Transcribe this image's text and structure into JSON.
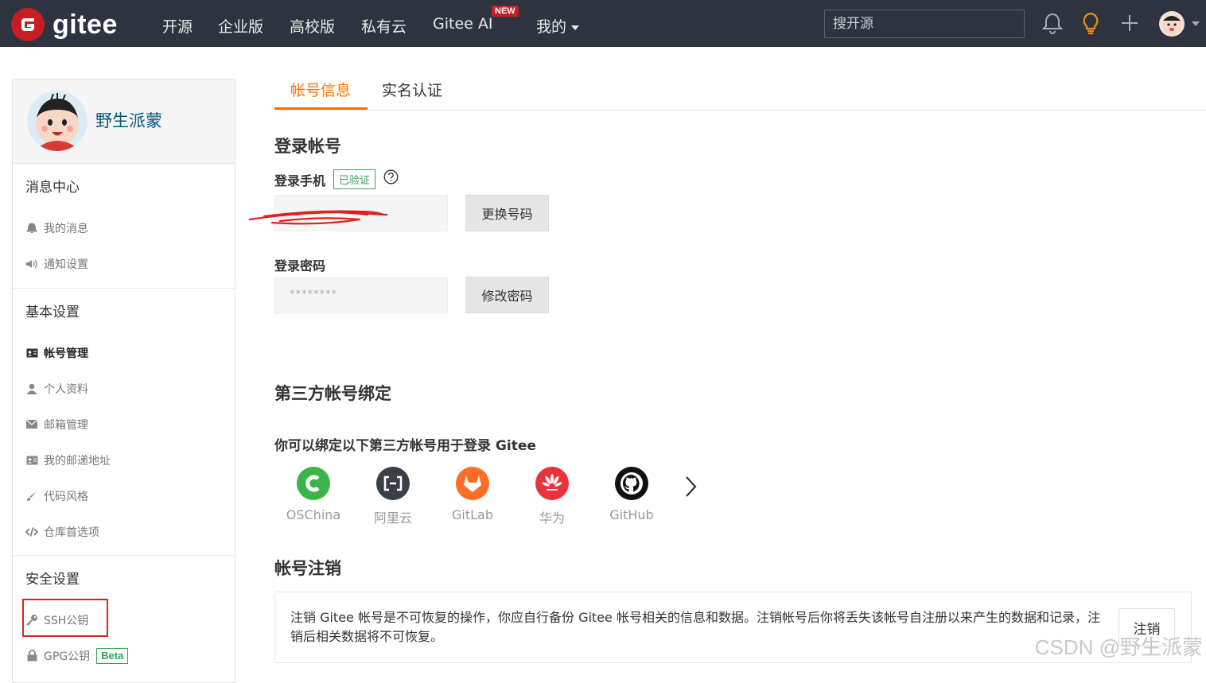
{
  "topnav": {
    "brand": "gitee",
    "items": [
      "开源",
      "企业版",
      "高校版",
      "私有云",
      "Gitee AI",
      "我的"
    ],
    "new_badge": "NEW",
    "search_placeholder": "搜开源"
  },
  "sidebar": {
    "username": "野生派蒙",
    "sections": [
      {
        "title": "消息中心",
        "items": [
          {
            "label": "我的消息",
            "icon": "bell-icon"
          },
          {
            "label": "通知设置",
            "icon": "speaker-icon"
          }
        ]
      },
      {
        "title": "基本设置",
        "items": [
          {
            "label": "帐号管理",
            "icon": "id-card-icon",
            "active": true
          },
          {
            "label": "个人资料",
            "icon": "user-icon"
          },
          {
            "label": "邮箱管理",
            "icon": "mail-icon"
          },
          {
            "label": "我的邮递地址",
            "icon": "address-card-icon"
          },
          {
            "label": "代码风格",
            "icon": "brush-icon"
          },
          {
            "label": "仓库首选项",
            "icon": "code-icon"
          }
        ]
      },
      {
        "title": "安全设置",
        "items": [
          {
            "label": "SSH公钥",
            "icon": "key-icon"
          },
          {
            "label": "GPG公钥",
            "icon": "lock-icon",
            "badge": "Beta"
          }
        ]
      }
    ]
  },
  "tabs": [
    "帐号信息",
    "实名认证"
  ],
  "login": {
    "title": "登录帐号",
    "phone_label": "登录手机",
    "verified": "已验证",
    "change_phone": "更换号码",
    "password_label": "登录密码",
    "password_mask": "********",
    "change_password": "修改密码"
  },
  "third_party": {
    "title": "第三方帐号绑定",
    "subtitle": "你可以绑定以下第三方帐号用于登录 Gitee",
    "providers": [
      {
        "name": "OSChina",
        "color": "#3bb54a"
      },
      {
        "name": "阿里云",
        "color": "#3a3f47"
      },
      {
        "name": "GitLab",
        "color": "#fc6d26"
      },
      {
        "name": "华为",
        "color": "#e8323c"
      },
      {
        "name": "GitHub",
        "color": "#111111"
      }
    ]
  },
  "cancel_account": {
    "title": "帐号注销",
    "text": "注销 Gitee 帐号是不可恢复的操作，你应自行备份 Gitee 帐号相关的信息和数据。注销帐号后你将丢失该帐号自注册以来产生的数据和记录，注销后相关数据将不可恢复。",
    "button": "注销"
  },
  "watermark": "CSDN @野生派蒙",
  "colors": {
    "accent": "#fe7300",
    "nav_bg": "#2d3440",
    "brand_red": "#c71d23",
    "link": "#005980"
  }
}
